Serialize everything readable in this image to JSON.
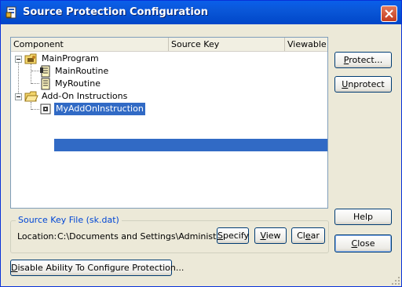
{
  "window": {
    "title": "Source Protection Configuration"
  },
  "table": {
    "columns": [
      "Component",
      "Source Key",
      "Viewable"
    ],
    "rows": [
      {
        "label": "MainProgram"
      },
      {
        "label": "MainRoutine"
      },
      {
        "label": "MyRoutine"
      },
      {
        "label": "Add-On Instructions"
      },
      {
        "label": "MyAddOnInstruction",
        "selected": true
      }
    ]
  },
  "buttons": {
    "protect": {
      "pre": "",
      "u": "P",
      "post": "rotect..."
    },
    "unprotect": {
      "pre": "",
      "u": "U",
      "post": "nprotect"
    },
    "help": "Help",
    "close": {
      "pre": "",
      "u": "C",
      "post": "lose"
    },
    "specify": {
      "pre": "",
      "u": "S",
      "post": "pecify"
    },
    "view": {
      "pre": "",
      "u": "V",
      "post": "iew"
    },
    "clear": {
      "pre": "Cl",
      "u": "e",
      "post": "ar"
    },
    "disable": {
      "pre": "",
      "u": "D",
      "post": "isable Ability To Configure Protection..."
    }
  },
  "key_file": {
    "group_label": "Source Key File (sk.dat)",
    "location_label": "Location:",
    "location_value": "C:\\Documents and Settings\\Administra..."
  },
  "colors": {
    "titlebar": "#0054E3",
    "selection": "#316AC5",
    "group_label": "#0046D5",
    "dialog": "#ECE9D8"
  }
}
